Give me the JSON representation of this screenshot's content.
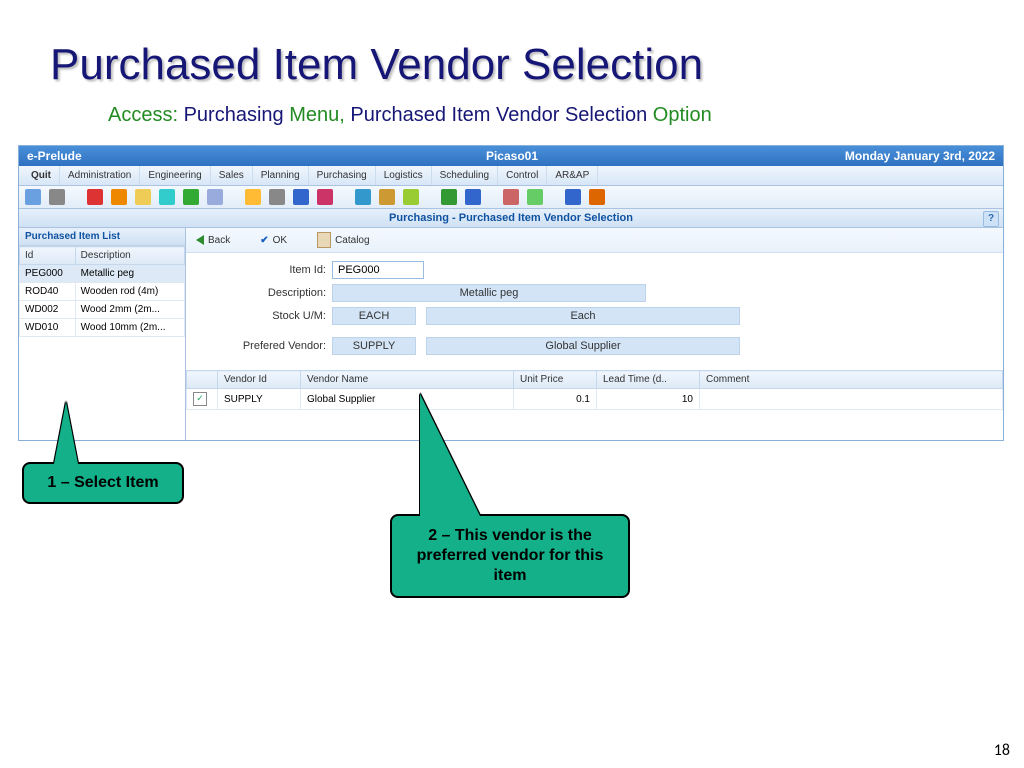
{
  "slide": {
    "title": "Purchased Item Vendor Selection",
    "access_label": "Access:",
    "access_path1": "Purchasing",
    "access_menu": "Menu,",
    "access_path2": "Purchased Item Vendor Selection",
    "access_option": "Option",
    "page_number": "18"
  },
  "app": {
    "name": "e-Prelude",
    "user": "Picaso01",
    "date": "Monday January 3rd, 2022",
    "menus": [
      "Quit",
      "Administration",
      "Engineering",
      "Sales",
      "Planning",
      "Purchasing",
      "Logistics",
      "Scheduling",
      "Control",
      "AR&AP"
    ],
    "section": "Purchasing - Purchased Item Vendor Selection"
  },
  "side_panel": {
    "title": "Purchased Item List",
    "cols": [
      "Id",
      "Description"
    ],
    "rows": [
      {
        "id": "PEG000",
        "desc": "Metallic peg",
        "selected": true
      },
      {
        "id": "ROD40",
        "desc": "Wooden rod (4m)"
      },
      {
        "id": "WD002",
        "desc": "Wood 2mm (2m..."
      },
      {
        "id": "WD010",
        "desc": "Wood 10mm (2m..."
      }
    ]
  },
  "toolbar": {
    "back": "Back",
    "ok": "OK",
    "catalog": "Catalog"
  },
  "form": {
    "item_id_label": "Item Id:",
    "item_id_value": "PEG000",
    "description_label": "Description:",
    "description_value": "Metallic peg",
    "stock_label": "Stock U/M:",
    "stock_code": "EACH",
    "stock_desc": "Each",
    "vendor_label": "Prefered Vendor:",
    "vendor_code": "SUPPLY",
    "vendor_name": "Global Supplier"
  },
  "vendor_grid": {
    "cols": [
      "",
      "Vendor Id",
      "Vendor Name",
      "Unit Price",
      "Lead Time (d..",
      "Comment"
    ],
    "rows": [
      {
        "checked": true,
        "id": "SUPPLY",
        "name": "Global Supplier",
        "price": "0.1",
        "lead": "10",
        "comment": ""
      }
    ]
  },
  "callouts": {
    "c1": "1 – Select Item",
    "c2": "2 – This vendor is the preferred vendor for this item"
  },
  "toolbar_icons": [
    "home",
    "print",
    "sep",
    "red",
    "orange",
    "folder",
    "cyan",
    "green",
    "clock",
    "sep",
    "sun",
    "grid",
    "bars",
    "pie",
    "sep",
    "cart",
    "box",
    "box2",
    "sep",
    "money",
    "card",
    "sep",
    "user",
    "user2",
    "sep",
    "help",
    "up"
  ]
}
